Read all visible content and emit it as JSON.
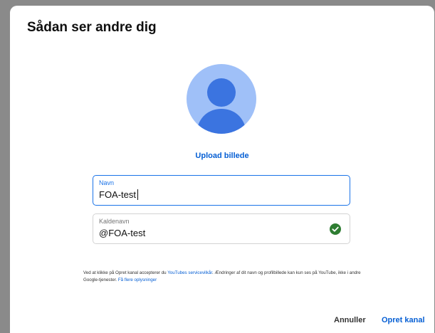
{
  "dialog": {
    "title": "Sådan ser andre dig",
    "upload_label": "Upload billede"
  },
  "avatar_icon": "default-profile-avatar-icon",
  "fields": {
    "name": {
      "label": "Navn",
      "value": "FOA-test"
    },
    "handle": {
      "label": "Kaldenavn",
      "value": "@FOA-test",
      "status_icon": "check-circle-icon"
    }
  },
  "terms": {
    "part1": "Ved at klikke på Opret kanal accepterer du ",
    "link1": "YouTubes servicevilkår",
    "part2": ". Ændringer af dit navn og profilbillede kan kun ses på YouTube, ikke i andre Google-tjenester. ",
    "link2": "Få flere oplysninger"
  },
  "actions": {
    "cancel": "Annuller",
    "create": "Opret kanal"
  },
  "colors": {
    "accent": "#065fd4",
    "focus_border": "#1a73e8",
    "avatar_bg": "#9fc0f8",
    "avatar_fg": "#3b74e0",
    "success": "#2e7d32"
  }
}
